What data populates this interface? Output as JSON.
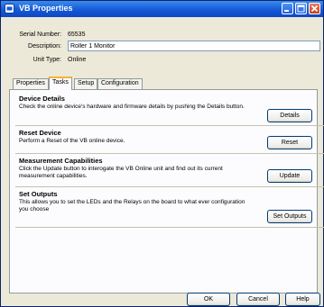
{
  "window": {
    "title": "VB Properties"
  },
  "info": {
    "serial_label": "Serial Number:",
    "serial_value": "65535",
    "description_label": "Description:",
    "description_value": "Roller 1 Monitor",
    "unit_type_label": "Unit Type:",
    "unit_type_value": "Online"
  },
  "tabs": [
    {
      "label": "Properties",
      "active": false
    },
    {
      "label": "Tasks",
      "active": true
    },
    {
      "label": "Setup",
      "active": false
    },
    {
      "label": "Configuration",
      "active": false
    }
  ],
  "sections": [
    {
      "title": "Device Details",
      "description": "Check the online device's hardware and firmware details by pushing the Details button.",
      "button": "Details"
    },
    {
      "title": "Reset Device",
      "description": "Perform a Reset of the VB online device.",
      "button": "Reset"
    },
    {
      "title": "Measurement Capabilities",
      "description": "Click the Update button to interogate the VB Online unit and find out its current measurement capabilities.",
      "button": "Update"
    },
    {
      "title": "Set Outputs",
      "description": "This allows you to set the LEDs and the Relays on the board to what ever configuration you choose",
      "button": "Set Outputs"
    }
  ],
  "footer": {
    "ok": "OK",
    "cancel": "Cancel",
    "help": "Help"
  },
  "colors": {
    "titlebar": "#1559d6",
    "tab_highlight": "#f8b13a",
    "close_button": "#c8431d"
  }
}
